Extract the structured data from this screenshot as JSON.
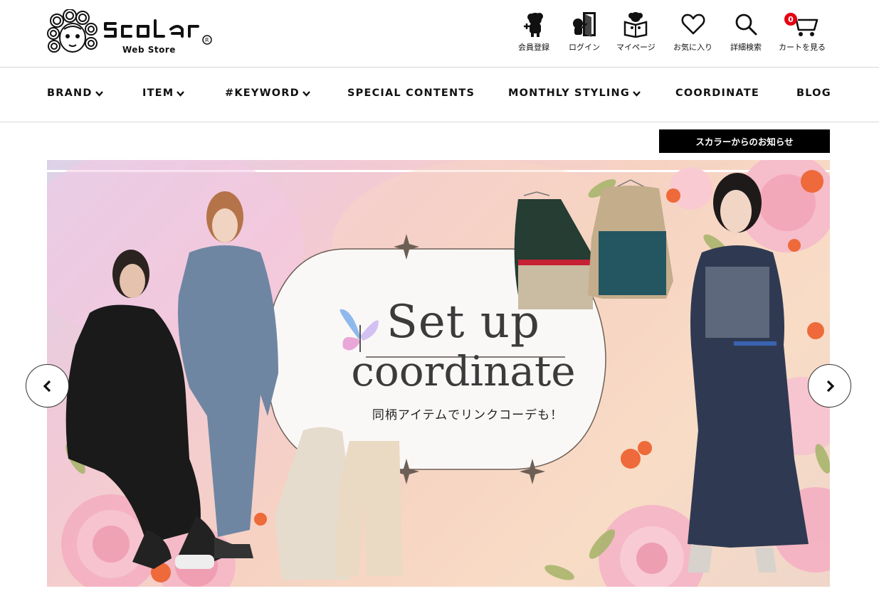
{
  "header": {
    "logo_text": "ScoLar",
    "logo_sub": "Web Store",
    "utility": [
      {
        "label": "会員登録",
        "icon": "register-icon"
      },
      {
        "label": "ログイン",
        "icon": "login-door-icon"
      },
      {
        "label": "マイページ",
        "icon": "mypage-icon"
      },
      {
        "label": "お気に入り",
        "icon": "heart-icon"
      },
      {
        "label": "詳細検索",
        "icon": "search-icon"
      },
      {
        "label": "カートを見る",
        "icon": "cart-icon",
        "badge": "0"
      }
    ]
  },
  "nav": {
    "items": [
      {
        "label": "BRAND",
        "dropdown": true
      },
      {
        "label": "ITEM",
        "dropdown": true
      },
      {
        "label": "#KEYWORD",
        "dropdown": true
      },
      {
        "label": "SPECIAL CONTENTS",
        "dropdown": false
      },
      {
        "label": "MONTHLY STYLING",
        "dropdown": true
      },
      {
        "label": "COORDINATE",
        "dropdown": false
      },
      {
        "label": "BLOG",
        "dropdown": false
      }
    ]
  },
  "notice": {
    "label": "スカラーからのお知らせ"
  },
  "banner": {
    "title_line1": "Set up",
    "title_line2": "coordinate",
    "subtitle": "同柄アイテムでリンクコーデも！",
    "prev_icon": "chevron-left-icon",
    "next_icon": "chevron-right-icon"
  },
  "colors": {
    "badge": "#e50012",
    "notice_bg": "#000000",
    "title_text": "#3b3b3b"
  }
}
